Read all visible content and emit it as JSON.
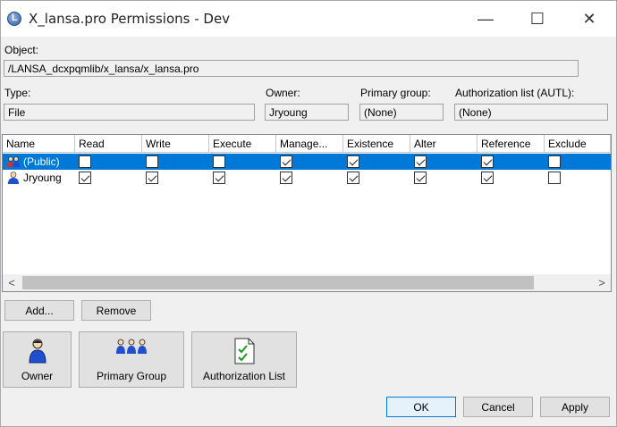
{
  "window": {
    "title": "X_lansa.pro Permissions - Dev",
    "minimize": "—",
    "maximize": "☐",
    "close": "✕"
  },
  "object": {
    "label": "Object:",
    "value": "/LANSA_dcxpqmlib/x_lansa/x_lansa.pro"
  },
  "type": {
    "label": "Type:",
    "value": "File"
  },
  "owner": {
    "label": "Owner:",
    "value": "Jryoung"
  },
  "primary_group": {
    "label": "Primary group:",
    "value": "(None)"
  },
  "authorization_list": {
    "label": "Authorization list (AUTL):",
    "value": "(None)"
  },
  "grid": {
    "columns": [
      "Name",
      "Read",
      "Write",
      "Execute",
      "Manage...",
      "Existence",
      "Alter",
      "Reference",
      "Exclude"
    ],
    "rows": [
      {
        "name": "(Public)",
        "icon": "group-users-icon",
        "selected": true,
        "checks": [
          false,
          false,
          false,
          true,
          true,
          true,
          true,
          false
        ]
      },
      {
        "name": "Jryoung",
        "icon": "user-icon",
        "selected": false,
        "checks": [
          true,
          true,
          true,
          true,
          true,
          true,
          true,
          false
        ]
      }
    ],
    "scroll_left": "<",
    "scroll_right": ">"
  },
  "buttons": {
    "add": "Add...",
    "remove": "Remove",
    "owner": "Owner",
    "primary_group": "Primary Group",
    "authorization_list": "Authorization List",
    "ok": "OK",
    "cancel": "Cancel",
    "apply": "Apply"
  },
  "colors": {
    "selection": "#0078d7",
    "window_bg": "#f0f0f0"
  }
}
